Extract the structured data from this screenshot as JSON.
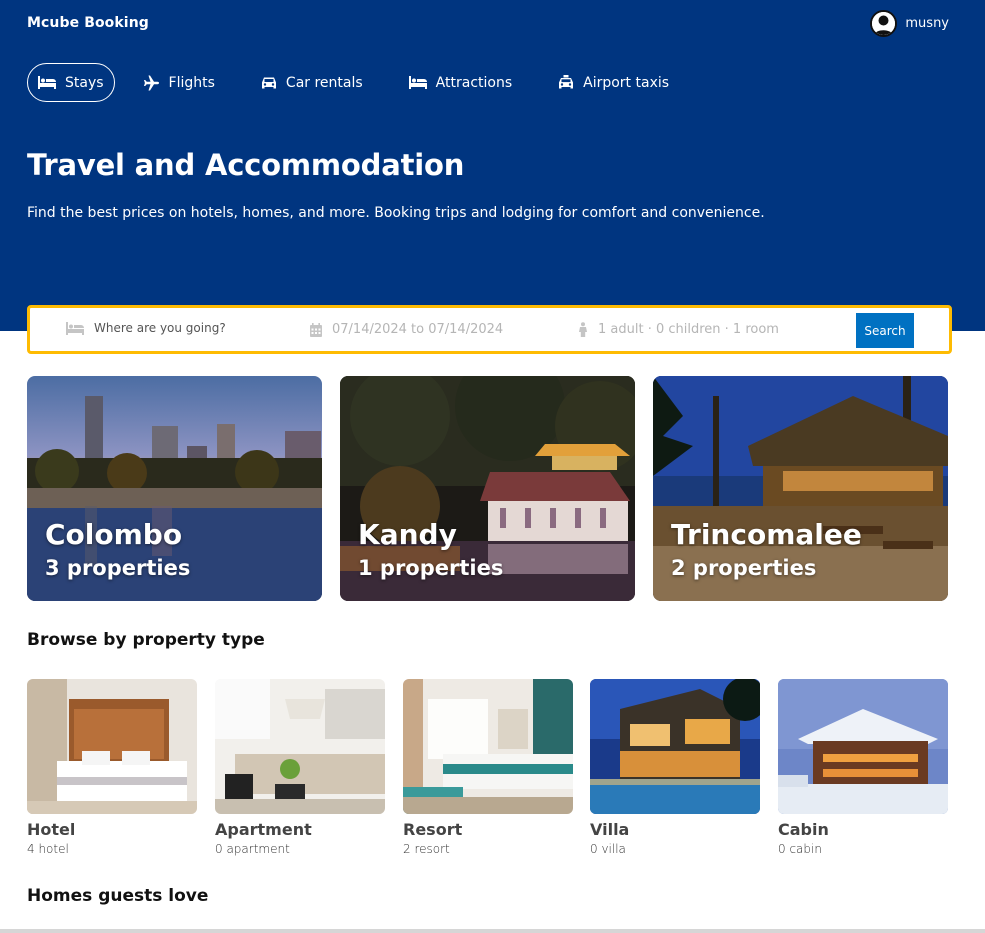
{
  "brand": "Mcube Booking",
  "user": {
    "name": "musny",
    "icon": "user-avatar-icon"
  },
  "nav": [
    {
      "label": "Stays",
      "icon": "bed-icon",
      "active": true
    },
    {
      "label": "Flights",
      "icon": "plane-icon",
      "active": false
    },
    {
      "label": "Car rentals",
      "icon": "car-icon",
      "active": false
    },
    {
      "label": "Attractions",
      "icon": "bed-icon",
      "active": false
    },
    {
      "label": "Airport taxis",
      "icon": "taxi-icon",
      "active": false
    }
  ],
  "hero": {
    "title": "Travel and Accommodation",
    "subtitle": "Find the best prices on hotels, homes, and more. Booking trips and lodging for comfort and convenience."
  },
  "search": {
    "destination_placeholder": "Where are you going?",
    "dates": "07/14/2024 to 07/14/2024",
    "guests": "1 adult · 0 children · 1 room",
    "button": "Search"
  },
  "cities": [
    {
      "name": "Colombo",
      "properties": "3 properties"
    },
    {
      "name": "Kandy",
      "properties": "1 properties"
    },
    {
      "name": "Trincomalee",
      "properties": "2 properties"
    }
  ],
  "property_section_title": "Browse by property type",
  "property_types": [
    {
      "name": "Hotel",
      "count": "4 hotel"
    },
    {
      "name": "Apartment",
      "count": "0 apartment"
    },
    {
      "name": "Resort",
      "count": "2 resort"
    },
    {
      "name": "Villa",
      "count": "0 villa"
    },
    {
      "name": "Cabin",
      "count": "0 cabin"
    }
  ],
  "homes_section_title": "Homes guests love",
  "colors": {
    "header_bg": "#003580",
    "accent": "#0071c2",
    "search_border": "#febb02"
  }
}
